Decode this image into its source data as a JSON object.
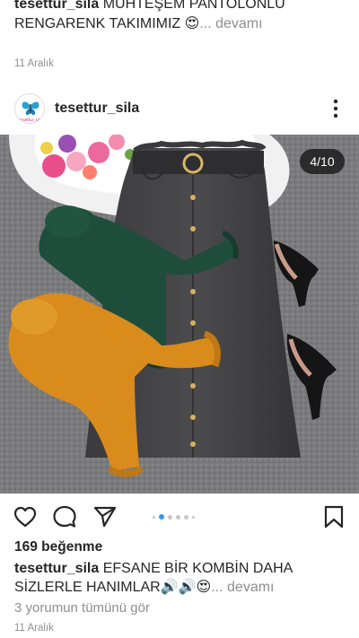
{
  "previous_post": {
    "username": "tesettur_sila",
    "caption": "MUHTEŞEM PANTOLONLU RENGARENK TAKIMIMIZ 😍",
    "more_label": "... devamı",
    "date": "11 Aralık"
  },
  "post": {
    "username": "tesettur_sila",
    "avatar_text": "tesettur_sila",
    "image_counter": "4/10",
    "likes": "169 beğenme",
    "caption": "EFSANE BİR KOMBİN DAHA SİZLERLE HANIMLAR🔊🔊😍",
    "more_label": "... devamı",
    "comments_link": "3 yorumun tümünü gör",
    "date": "11 Aralık",
    "carousel_dot_count": 6,
    "carousel_active_index": 1
  },
  "icons": {
    "like": "heart-icon",
    "comment": "comment-icon",
    "share": "send-icon",
    "save": "bookmark-icon",
    "more": "more-vertical-icon"
  },
  "colors": {
    "accent_blue": "#3897f0",
    "text_primary": "#262626",
    "text_secondary": "#8e8e8e"
  }
}
